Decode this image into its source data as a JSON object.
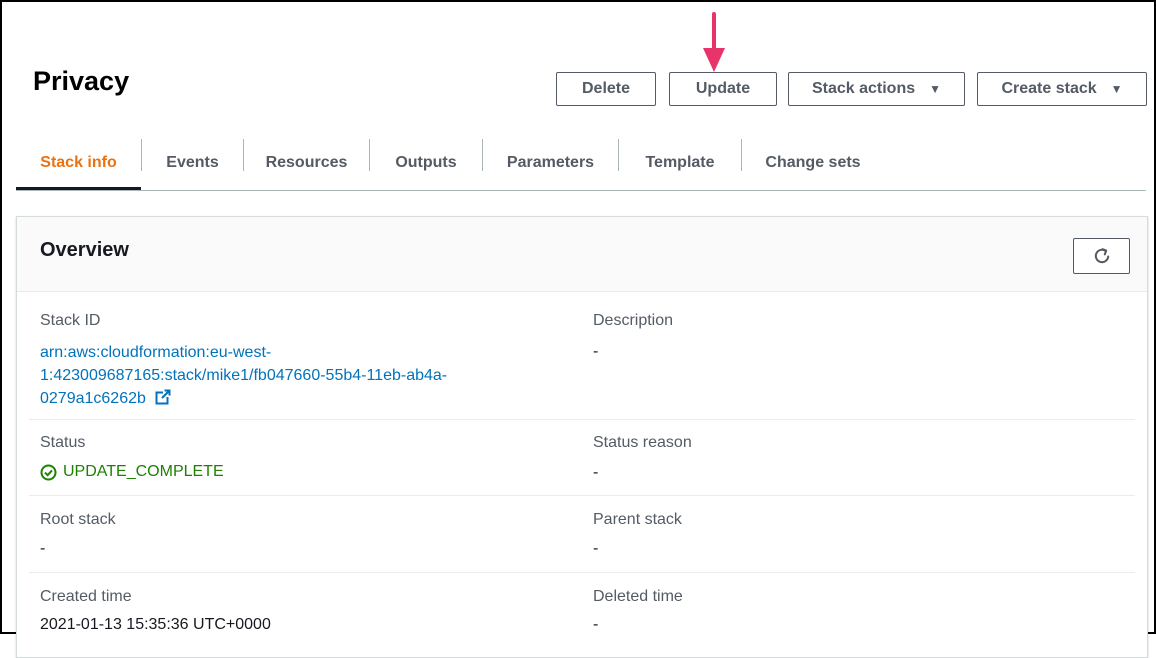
{
  "page": {
    "title": "Privacy"
  },
  "actions": {
    "delete": "Delete",
    "update": "Update",
    "stack_actions": "Stack actions",
    "create_stack": "Create stack"
  },
  "tabs": [
    {
      "label": "Stack info",
      "active": true
    },
    {
      "label": "Events"
    },
    {
      "label": "Resources"
    },
    {
      "label": "Outputs"
    },
    {
      "label": "Parameters"
    },
    {
      "label": "Template"
    },
    {
      "label": "Change sets"
    }
  ],
  "overview": {
    "title": "Overview",
    "stack_id_label": "Stack ID",
    "stack_id_line1": "arn:aws:cloudformation:eu-west-",
    "stack_id_line2": "1:423009687165:stack/mike1/fb047660-55b4-11eb-ab4a-",
    "stack_id_line3": "0279a1c6262b",
    "description_label": "Description",
    "description_value": "-",
    "status_label": "Status",
    "status_value": "UPDATE_COMPLETE",
    "status_reason_label": "Status reason",
    "status_reason_value": "-",
    "root_stack_label": "Root stack",
    "root_stack_value": "-",
    "parent_stack_label": "Parent stack",
    "parent_stack_value": "-",
    "created_time_label": "Created time",
    "created_time_value": "2021-01-13 15:35:36 UTC+0000",
    "deleted_time_label": "Deleted time",
    "deleted_time_value": "-"
  },
  "icons": {
    "arrow": "down-arrow-annotation",
    "dropdown": "caret-down-icon",
    "refresh": "refresh-icon",
    "external": "external-link-icon",
    "status": "check-circle-icon"
  },
  "colors": {
    "accent_tab": "#ec7211",
    "link": "#0073bb",
    "success": "#1d8102",
    "annotation_arrow": "#e8336b"
  }
}
